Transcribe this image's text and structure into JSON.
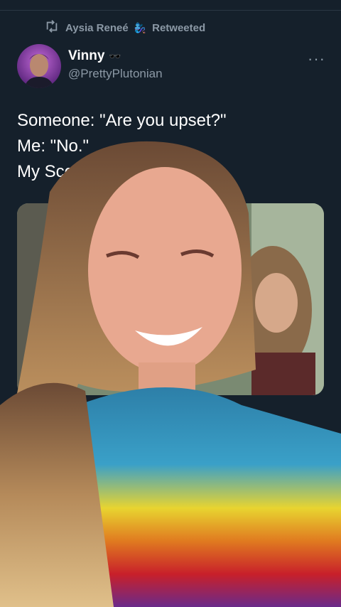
{
  "retweet": {
    "user_name": "Aysia Reneé",
    "emoji": "🧞‍♀️",
    "action_label": "Retweeted"
  },
  "tweet": {
    "author_name": "Vinny",
    "author_badge_emoji": "🕶️",
    "author_handle": "@PrettyPlutonian",
    "more_label": "···",
    "lines": [
      "Someone: \"Are you upset?\"",
      "Me: \"No.\"",
      "My Scorp"
    ]
  },
  "colors": {
    "background": "#15202b",
    "secondary_text": "#8b98a5",
    "primary_text": "#ffffff"
  }
}
